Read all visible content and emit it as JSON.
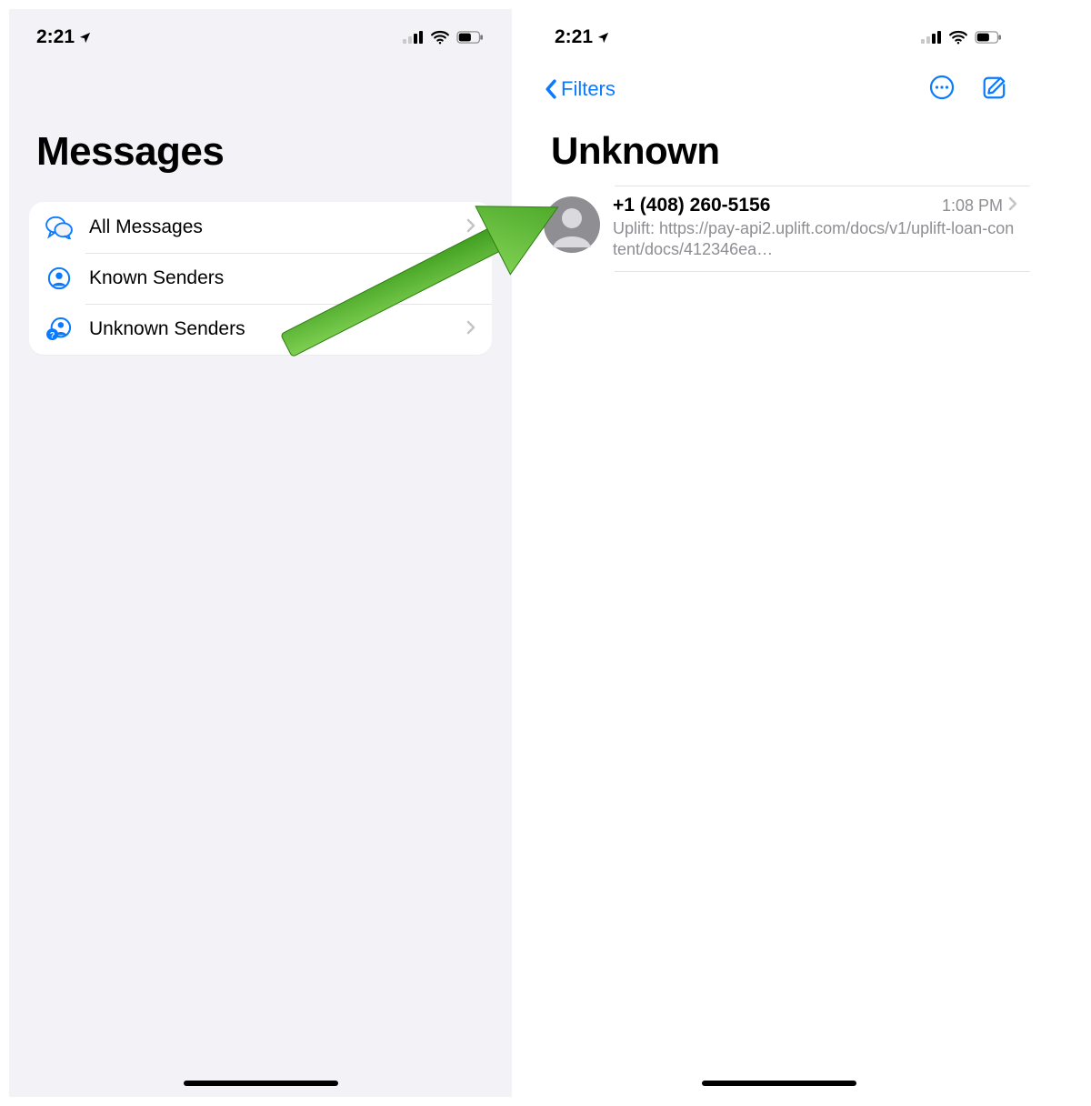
{
  "status": {
    "time": "2:21"
  },
  "left": {
    "title": "Messages",
    "filters": [
      {
        "label": "All Messages",
        "icon": "chat-bubbles-icon",
        "disclosure": true
      },
      {
        "label": "Known Senders",
        "icon": "person-circle-icon",
        "disclosure": false
      },
      {
        "label": "Unknown Senders",
        "icon": "person-question-icon",
        "disclosure": true
      }
    ]
  },
  "right": {
    "back_label": "Filters",
    "title": "Unknown",
    "conversations": [
      {
        "sender": "+1 (408) 260-5156",
        "time": "1:08 PM",
        "preview": "Uplift: https://pay-api2.uplift.com/docs/v1/uplift-loan-content/docs/412346ea…"
      }
    ]
  },
  "colors": {
    "ios_blue": "#0a7aff",
    "ios_gray": "#8e8e93",
    "arrow_green": "#5fb73a"
  }
}
